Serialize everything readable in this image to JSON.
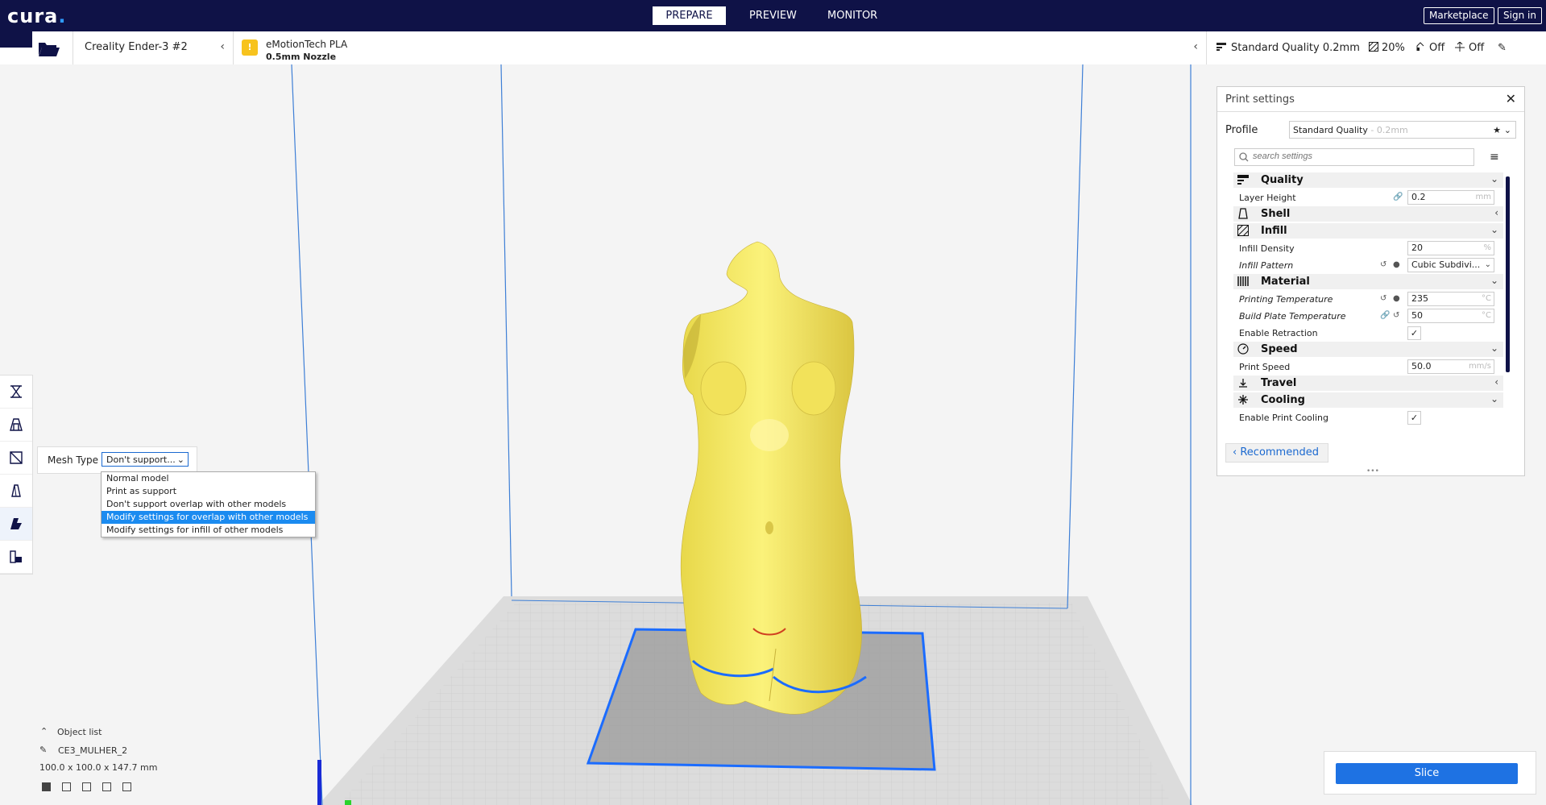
{
  "header": {
    "logo": "cura",
    "stages": [
      "PREPARE",
      "PREVIEW",
      "MONITOR"
    ],
    "active_stage": "PREPARE",
    "marketplace_label": "Marketplace",
    "signin_label": "Sign in"
  },
  "printer": {
    "name": "Creality Ender-3 #2"
  },
  "material": {
    "name": "eMotionTech PLA",
    "nozzle": "0.5mm Nozzle",
    "badge": "!"
  },
  "quality_summary": {
    "profile": "Standard Quality 0.2mm",
    "infill": "20%",
    "support": "Off",
    "adhesion": "Off"
  },
  "mesh_type": {
    "label": "Mesh Type",
    "selected": "Don't support...",
    "options": [
      "Normal model",
      "Print as support",
      "Don't support overlap with other models",
      "Modify settings for overlap with other models",
      "Modify settings for infill of other models"
    ],
    "highlighted_index": 3
  },
  "object_list": {
    "title": "Object list",
    "object_name": "CE3_MULHER_2",
    "dimensions": "100.0 x 100.0 x 147.7 mm"
  },
  "print_settings": {
    "title": "Print settings",
    "profile_label": "Profile",
    "profile_value": "Standard Quality",
    "profile_sub": " - 0.2mm",
    "search_placeholder": "search settings",
    "categories": {
      "quality": "Quality",
      "shell": "Shell",
      "infill": "Infill",
      "material": "Material",
      "speed": "Speed",
      "travel": "Travel",
      "cooling": "Cooling"
    },
    "settings": {
      "layer_height": {
        "name": "Layer Height",
        "value": "0.2",
        "unit": "mm"
      },
      "infill_density": {
        "name": "Infill Density",
        "value": "20",
        "unit": "%"
      },
      "infill_pattern": {
        "name": "Infill Pattern",
        "value": "Cubic Subdivi..."
      },
      "printing_temperature": {
        "name": "Printing Temperature",
        "value": "235",
        "unit": "°C"
      },
      "build_plate_temperature": {
        "name": "Build Plate Temperature",
        "value": "50",
        "unit": "°C"
      },
      "enable_retraction": {
        "name": "Enable Retraction",
        "checked": true
      },
      "print_speed": {
        "name": "Print Speed",
        "value": "50.0",
        "unit": "mm/s"
      },
      "enable_print_cooling": {
        "name": "Enable Print Cooling",
        "checked": true
      }
    },
    "recommended_label": "Recommended"
  },
  "slice": {
    "label": "Slice"
  },
  "colors": {
    "header_bg": "#0f1247",
    "accent": "#1e72e3",
    "model_yellow": "#f7ec6a",
    "selection_blue": "#1b6cff"
  }
}
